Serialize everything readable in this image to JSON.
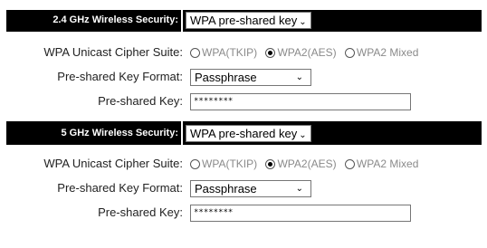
{
  "sections": [
    {
      "header_label": "2.4 GHz Wireless Security:",
      "security_mode": "WPA pre-shared key",
      "cipher_label": "WPA Unicast Cipher Suite:",
      "cipher_options": [
        "WPA(TKIP)",
        "WPA2(AES)",
        "WPA2 Mixed"
      ],
      "cipher_selected": "WPA2(AES)",
      "format_label": "Pre-shared Key Format:",
      "format_value": "Passphrase",
      "key_label": "Pre-shared Key:",
      "key_value": "********"
    },
    {
      "header_label": "5 GHz Wireless Security:",
      "security_mode": "WPA pre-shared key",
      "cipher_label": "WPA Unicast Cipher Suite:",
      "cipher_options": [
        "WPA(TKIP)",
        "WPA2(AES)",
        "WPA2 Mixed"
      ],
      "cipher_selected": "WPA2(AES)",
      "format_label": "Pre-shared Key Format:",
      "format_value": "Passphrase",
      "key_label": "Pre-shared Key:",
      "key_value": "********"
    }
  ],
  "icons": {
    "dropdown": "chevron-down-icon"
  },
  "colors": {
    "header_bg": "#000000",
    "header_text": "#ffffff",
    "disabled_text": "#8a8a8a"
  }
}
